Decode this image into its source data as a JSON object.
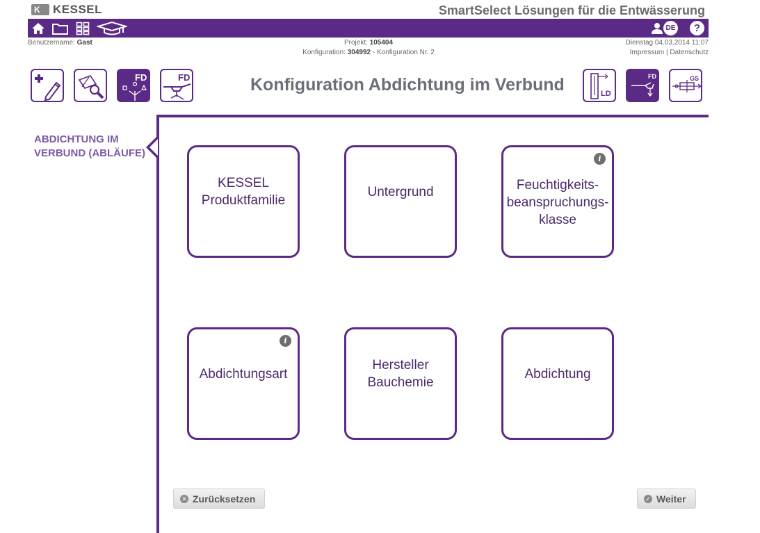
{
  "brand": {
    "logo_letter": "K",
    "logo_name": "KESSEL"
  },
  "app_title": "SmartSelect Lösungen für die Entwässerung",
  "navbar": {
    "lang": "DE",
    "help": "?",
    "icons": [
      "home-icon",
      "folder-icon",
      "grid-icon",
      "graduation-cap-icon",
      "user-icon"
    ]
  },
  "info": {
    "username_label": "Benutzername:",
    "username": "Gast",
    "project_label": "Projekt:",
    "project": "105404",
    "config_label": "Konfiguration:",
    "config_id": "304992",
    "config_name": "- Konfiguration Nr. 2",
    "datetime": "Dienstag 04.03.2014 11:07",
    "impressum": "Impressum",
    "separator": "|",
    "datenschutz": "Datenschutz"
  },
  "toolbar": {
    "tiles_left": [
      {
        "icon": "new-pencil-icon"
      },
      {
        "icon": "search-plan-icon"
      },
      {
        "icon": "fd-config-icon",
        "label": "FD",
        "active": true
      },
      {
        "icon": "fd-drain-icon",
        "label": "FD"
      }
    ],
    "tiles_right": [
      {
        "icon": "ld-icon",
        "label": "LD"
      },
      {
        "icon": "fd-pipe-icon",
        "label": "FD",
        "active": true
      },
      {
        "icon": "gs-icon",
        "label": "GS"
      }
    ]
  },
  "page_title": "Konfiguration Abdichtung im Verbund",
  "sidebar": {
    "title": "ABDICHTUNG IM VERBUND (ABLÄUFE)"
  },
  "cards": [
    {
      "label": "KESSEL Produktfamilie",
      "info": false
    },
    {
      "label": "Untergrund",
      "info": false
    },
    {
      "label": "Feuchtigkeits-beanspruchungs-klasse",
      "info": true
    },
    {
      "label": "Abdichtungsart",
      "info": true
    },
    {
      "label": "Hersteller Bauchemie",
      "info": false
    },
    {
      "label": "Abdichtung",
      "info": false
    }
  ],
  "info_glyph": "i",
  "buttons": {
    "reset": {
      "label": "Zurücksetzen",
      "glyph": "✕"
    },
    "next": {
      "label": "Weiter",
      "glyph": "✓"
    }
  },
  "colors": {
    "accent": "#5b2a86",
    "sidebar_text": "#7c5aa6",
    "title_gray": "#6a6f78"
  }
}
